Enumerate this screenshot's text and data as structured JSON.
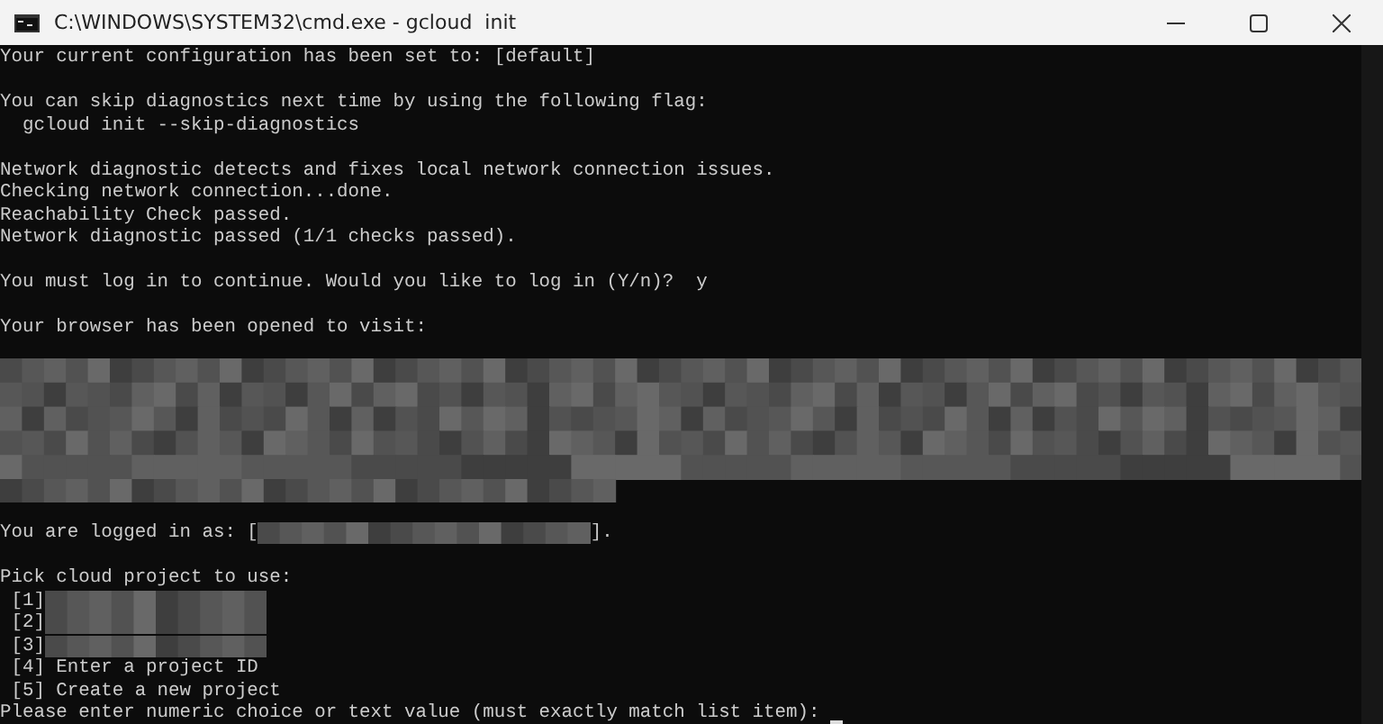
{
  "window": {
    "title": "C:\\WINDOWS\\SYSTEM32\\cmd.exe - gcloud  init"
  },
  "lines": [
    {
      "kind": "text",
      "text": "Your current configuration has been set to: [default]"
    },
    {
      "kind": "blank"
    },
    {
      "kind": "text",
      "text": "You can skip diagnostics next time by using the following flag:"
    },
    {
      "kind": "text",
      "text": "  gcloud init --skip-diagnostics"
    },
    {
      "kind": "blank"
    },
    {
      "kind": "text",
      "text": "Network diagnostic detects and fixes local network connection issues."
    },
    {
      "kind": "text",
      "text": "Checking network connection...done."
    },
    {
      "kind": "text",
      "text": "Reachability Check passed."
    },
    {
      "kind": "text",
      "text": "Network diagnostic passed (1/1 checks passed)."
    },
    {
      "kind": "blank"
    },
    {
      "kind": "text",
      "text": "You must log in to continue. Would you like to log in (Y/n)?  y"
    },
    {
      "kind": "blank"
    },
    {
      "kind": "text",
      "text": "Your browser has been opened to visit:"
    },
    {
      "kind": "redacted_block"
    },
    {
      "kind": "redacted_inline",
      "prefix": "You are logged in as: [",
      "suffix": "]."
    },
    {
      "kind": "blank"
    },
    {
      "kind": "text",
      "text": "Pick cloud project to use:"
    },
    {
      "kind": "redacted_inline",
      "prefix": " [1]"
    },
    {
      "kind": "redacted_inline",
      "prefix": " [2]"
    },
    {
      "kind": "redacted_inline",
      "prefix": " [3]"
    },
    {
      "kind": "text",
      "text": " [4] Enter a project ID"
    },
    {
      "kind": "text",
      "text": " [5] Create a new project"
    },
    {
      "kind": "prompt",
      "text": "Please enter numeric choice or text value (must exactly match list item): "
    }
  ]
}
